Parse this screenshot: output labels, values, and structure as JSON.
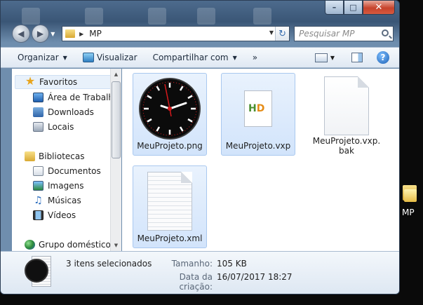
{
  "window": {
    "path": "MP",
    "search_placeholder": "Pesquisar MP",
    "caption": {
      "min": "–",
      "max": "□",
      "close": "✕"
    }
  },
  "toolbar": {
    "organize": "Organizar",
    "view": "Visualizar",
    "share": "Compartilhar com",
    "more": "»"
  },
  "navpane": {
    "favorites_label": "Favoritos",
    "favorites": [
      "Área de Trabalho",
      "Downloads",
      "Locais"
    ],
    "libraries_label": "Bibliotecas",
    "libraries": [
      "Documentos",
      "Imagens",
      "Músicas",
      "Vídeos"
    ],
    "homegroup_label": "Grupo doméstico"
  },
  "files": [
    {
      "name": "MeuProjeto.png",
      "selected": true,
      "icon": "clock-thumbnail"
    },
    {
      "name": "MeuProjeto.vxp",
      "selected": true,
      "icon": "vxp-document-icon"
    },
    {
      "name": "MeuProjeto.vxp.bak",
      "selected": false,
      "icon": "blank-document-icon"
    },
    {
      "name": "MeuProjeto.xml",
      "selected": true,
      "icon": "text-document-icon"
    }
  ],
  "details": {
    "count": "3 itens selecionados",
    "size_label": "Tamanho:",
    "size_value": "105 KB",
    "date_label": "Data da criação:",
    "date_value": "16/07/2017 18:27"
  },
  "desktop": {
    "folder_label": "MP"
  },
  "colors": {
    "selection": "#d2e4fb",
    "selection_border": "#a9c8ef",
    "clock_hand": "#d7191c"
  }
}
